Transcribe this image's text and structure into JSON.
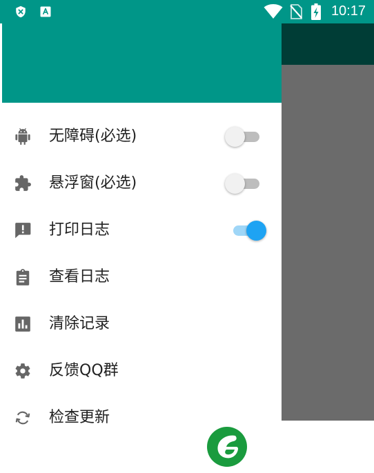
{
  "status_bar": {
    "time": "10:17",
    "background": "#009688",
    "left_icons": [
      "shield-x-icon",
      "accessibility-a-icon"
    ],
    "right_icons": [
      "wifi-icon",
      "no-sim-icon",
      "battery-charging-icon"
    ]
  },
  "drawer": {
    "header_color": "#009688",
    "menu": [
      {
        "label": "无障碍(必选)",
        "icon": "android-icon",
        "switch": "off"
      },
      {
        "label": "悬浮窗(必选)",
        "icon": "puzzle-icon",
        "switch": "off"
      },
      {
        "label": "打印日志",
        "icon": "feedback-alert-icon",
        "switch": "on"
      },
      {
        "label": "查看日志",
        "icon": "clipboard-icon"
      },
      {
        "label": "清除记录",
        "icon": "bar-chart-icon"
      },
      {
        "label": "反馈QQ群",
        "icon": "gear-icon"
      },
      {
        "label": "检查更新",
        "icon": "sync-icon"
      }
    ]
  },
  "colors": {
    "accent": "#1ea3f3",
    "scrim": "#6b6b6b",
    "toolbar_dark": "#003d36",
    "logo_green": "#1a9b3e"
  }
}
